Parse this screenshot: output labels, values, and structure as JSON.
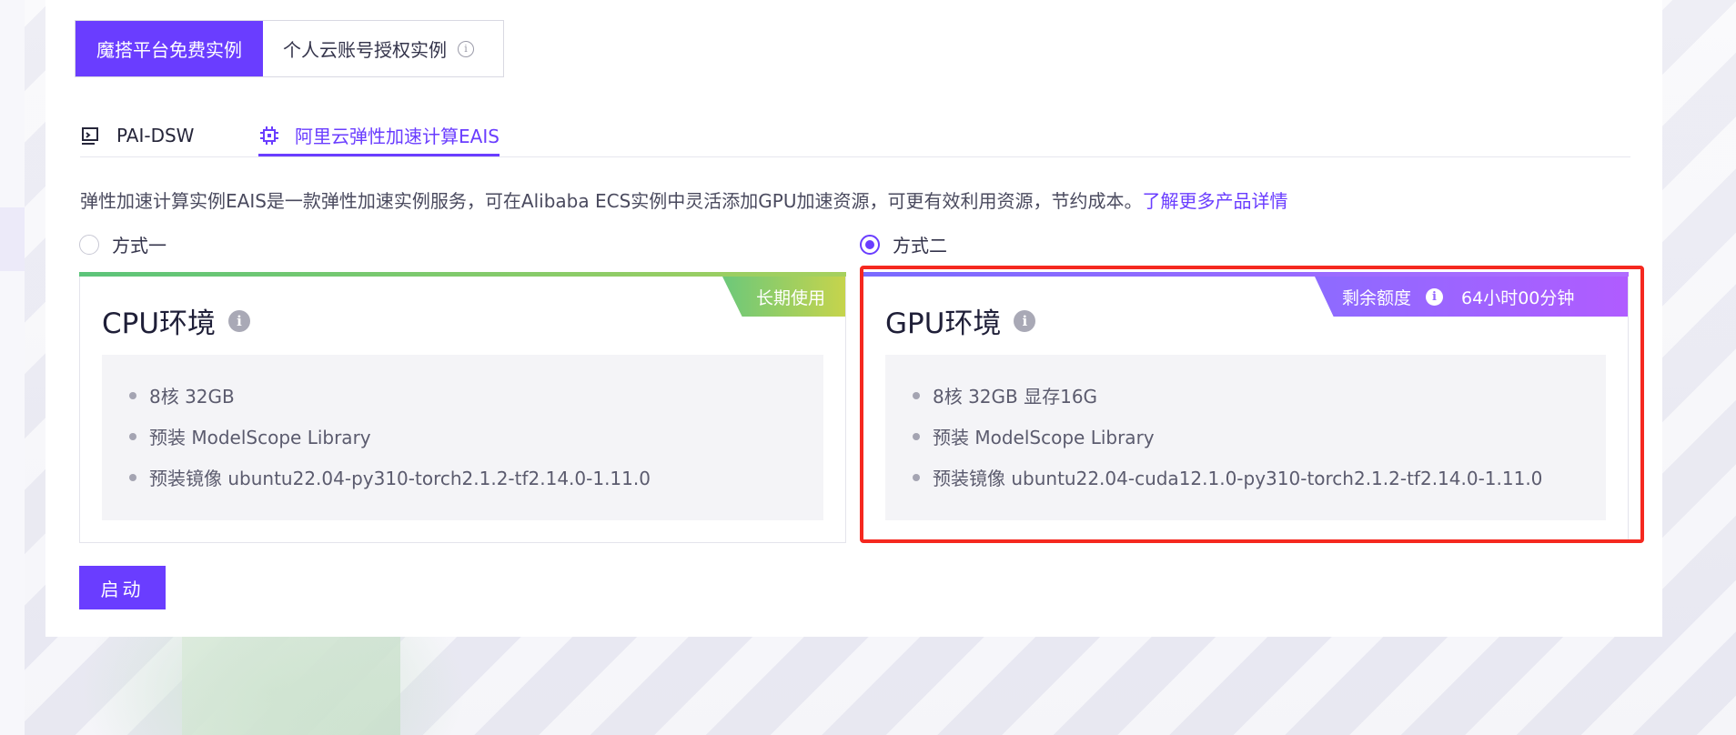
{
  "instance_tabs": [
    {
      "label": "魔搭平台免费实例",
      "active": true
    },
    {
      "label": "个人云账号授权实例",
      "active": false
    }
  ],
  "env_tabs": [
    {
      "label": "PAI-DSW",
      "icon": "terminal-icon",
      "active": false
    },
    {
      "label": "阿里云弹性加速计算EAIS",
      "icon": "chip-icon",
      "active": true
    }
  ],
  "description": {
    "text": "弹性加速计算实例EAIS是一款弹性加速实例服务，可在Alibaba ECS实例中灵活添加GPU加速资源，可更有效利用资源，节约成本。",
    "link": "了解更多产品详情"
  },
  "options": [
    {
      "radio_label": "方式一",
      "checked": false,
      "title": "CPU环境",
      "badge": "长期使用",
      "specs": [
        "8核 32GB",
        "预装 ModelScope Library",
        "预装镜像  ubuntu22.04-py310-torch2.1.2-tf2.14.0-1.11.0"
      ]
    },
    {
      "radio_label": "方式二",
      "checked": true,
      "title": "GPU环境",
      "badge_label": "剩余额度",
      "badge_value": "64小时00分钟",
      "specs": [
        "8核 32GB 显存16G",
        "预装 ModelScope Library",
        "预装镜像  ubuntu22.04-cuda12.1.0-py310-torch2.1.2-tf2.14.0-1.11.0"
      ]
    }
  ],
  "start_button": "启动",
  "colors": {
    "accent": "#6a3dff",
    "highlight_border": "#f5281f"
  }
}
